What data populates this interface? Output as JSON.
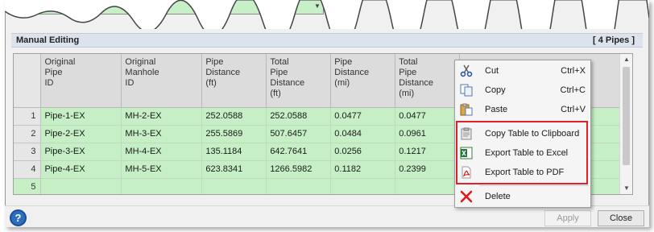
{
  "section": {
    "title": "Manual Editing",
    "count": "[ 4 Pipes ]"
  },
  "table": {
    "columns": [
      "Original\nPipe\nID",
      "Original\nManhole\nID",
      "Pipe\nDistance\n(ft)",
      "Total\nPipe\nDistance\n(ft)",
      "Pipe\nDistance\n(mi)",
      "Total\nPipe\nDistance\n(mi)"
    ],
    "rows": [
      {
        "num": "1",
        "cells": [
          "Pipe-1-EX",
          "MH-2-EX",
          "252.0588",
          "252.0588",
          "0.0477",
          "0.0477"
        ]
      },
      {
        "num": "2",
        "cells": [
          "Pipe-2-EX",
          "MH-3-EX",
          "255.5869",
          "507.6457",
          "0.0484",
          "0.0961"
        ]
      },
      {
        "num": "3",
        "cells": [
          "Pipe-3-EX",
          "MH-4-EX",
          "135.1184",
          "642.7641",
          "0.0256",
          "0.1217"
        ]
      },
      {
        "num": "4",
        "cells": [
          "Pipe-4-EX",
          "MH-5-EX",
          "623.8341",
          "1266.5982",
          "0.1182",
          "0.2399"
        ]
      },
      {
        "num": "5",
        "cells": [
          "",
          "",
          "",
          "",
          "",
          ""
        ]
      }
    ]
  },
  "menu": {
    "items": [
      {
        "label": "Cut",
        "shortcut": "Ctrl+X",
        "icon": "scissors-icon"
      },
      {
        "label": "Copy",
        "shortcut": "Ctrl+C",
        "icon": "copy-icon"
      },
      {
        "label": "Paste",
        "shortcut": "Ctrl+V",
        "icon": "paste-icon"
      },
      {
        "label": "Copy Table to Clipboard",
        "shortcut": "",
        "icon": "clipboard-icon"
      },
      {
        "label": "Export Table to Excel",
        "shortcut": "",
        "icon": "excel-icon"
      },
      {
        "label": "Export Table to PDF",
        "shortcut": "",
        "icon": "pdf-icon"
      },
      {
        "label": "Delete",
        "shortcut": "",
        "icon": "delete-icon"
      }
    ]
  },
  "footer": {
    "help_label": "?",
    "apply_label": "Apply",
    "close_label": "Close"
  },
  "colors": {
    "row_green": "#c6efc6",
    "highlight_red": "#e0202a",
    "header_blue": "#dce3ec"
  }
}
